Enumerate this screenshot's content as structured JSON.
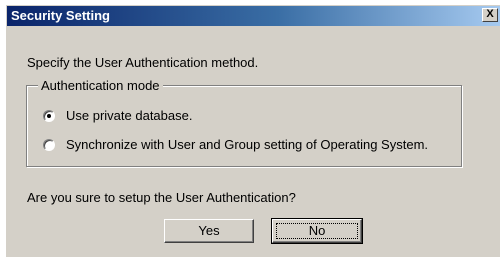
{
  "window": {
    "title": "Security Setting",
    "close_label": "X"
  },
  "instruction": "Specify the User Authentication method.",
  "auth_group": {
    "legend": "Authentication mode",
    "options": [
      {
        "label": "Use private database.",
        "checked": true
      },
      {
        "label": "Synchronize with User and Group setting of Operating System.",
        "checked": false
      }
    ]
  },
  "question": "Are you sure to setup the User Authentication?",
  "buttons": {
    "yes_label": "Yes",
    "no_label": "No"
  },
  "colors": {
    "titlebar_start": "#0a246a",
    "titlebar_end": "#a6caf0",
    "dialog_face": "#d4d0c8"
  }
}
